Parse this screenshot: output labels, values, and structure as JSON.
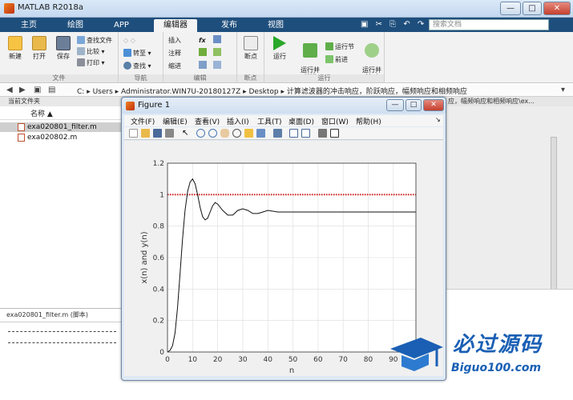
{
  "app": {
    "title": "MATLAB R2018a"
  },
  "window_controls": {
    "minimize": "—",
    "maximize": "□",
    "close": "✕"
  },
  "ribbon_tabs": [
    "主页",
    "绘图",
    "APP",
    "编辑器",
    "发布",
    "视图"
  ],
  "search": {
    "placeholder": "搜索文档"
  },
  "ribbon": {
    "file": {
      "new": "新建",
      "open": "打开",
      "save": "保存",
      "find_files": "查找文件",
      "compare": "比较",
      "print": "打印",
      "label": "文件"
    },
    "nav": {
      "goto": "转至",
      "find": "查找",
      "label": "导航"
    },
    "edit": {
      "insert": "插入",
      "comment": "注释",
      "indent": "缩进",
      "fx": "fx",
      "label": "编辑"
    },
    "breakpoints": {
      "bp": "断点",
      "label": "断点"
    },
    "run": {
      "run": "运行",
      "run_advance": "运行并\n前进",
      "run_section": "运行节",
      "advance": "前进",
      "run_time": "运行并\n计时",
      "label": "运行"
    }
  },
  "address": {
    "drive": "C:",
    "users": "Users",
    "admin": "Administrator.WIN7U-20180127Z",
    "desktop": "Desktop",
    "folder": "计算滤波器的冲击响应，阶跃响应，幅频响应和相频响应"
  },
  "current_folder": {
    "title": "当前文件夹",
    "col_name": "名称",
    "files": [
      "exa020801_filter.m",
      "exa020802.m"
    ]
  },
  "details": {
    "title": "exa020801_filter.m  (脚本)"
  },
  "editor_tab": "应，幅频响应和相频响应\\ex...",
  "figure": {
    "title": "Figure 1",
    "menus": [
      "文件(F)",
      "编辑(E)",
      "查看(V)",
      "插入(I)",
      "工具(T)",
      "桌面(D)",
      "窗口(W)",
      "帮助(H)"
    ]
  },
  "chart_data": {
    "type": "line",
    "xlabel": "n",
    "ylabel": "x(n)  and  y(n)",
    "xlim": [
      0,
      99
    ],
    "ylim": [
      0,
      1.2
    ],
    "xticks": [
      0,
      10,
      20,
      30,
      40,
      50,
      60,
      70,
      80,
      90
    ],
    "yticks": [
      0,
      0.2,
      0.4,
      0.6,
      0.8,
      1,
      1.2
    ],
    "grid": true,
    "series": [
      {
        "color": "#d62020",
        "style": "dotted",
        "x": [
          0,
          99
        ],
        "y": [
          1,
          1
        ]
      },
      {
        "color": "#111111",
        "style": "solid",
        "x": [
          0,
          1,
          2,
          3,
          4,
          5,
          6,
          7,
          8,
          9,
          10,
          11,
          12,
          13,
          14,
          15,
          16,
          17,
          18,
          19,
          20,
          22,
          24,
          26,
          28,
          30,
          32,
          34,
          36,
          38,
          40,
          44,
          48,
          52,
          56,
          60,
          70,
          80,
          90,
          99
        ],
        "y": [
          0,
          0.01,
          0.04,
          0.12,
          0.28,
          0.5,
          0.72,
          0.9,
          1.02,
          1.08,
          1.1,
          1.07,
          1.0,
          0.92,
          0.86,
          0.84,
          0.85,
          0.89,
          0.93,
          0.95,
          0.94,
          0.9,
          0.87,
          0.87,
          0.9,
          0.91,
          0.9,
          0.88,
          0.88,
          0.89,
          0.9,
          0.89,
          0.89,
          0.89,
          0.89,
          0.89,
          0.89,
          0.89,
          0.89,
          0.89
        ]
      }
    ]
  },
  "watermark": {
    "text": "必过源码",
    "url": "Biguo100.com"
  }
}
